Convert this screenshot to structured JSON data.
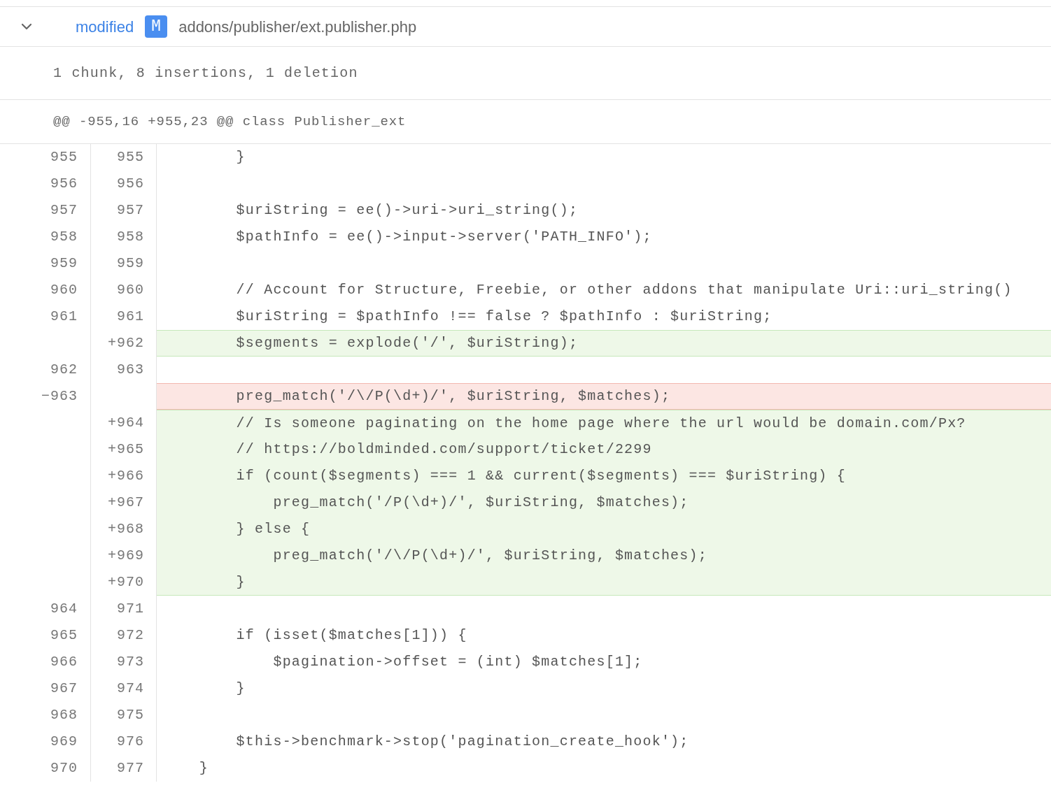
{
  "file": {
    "expanded": true,
    "status": "modified",
    "badge": "M",
    "path": "addons/publisher/ext.publisher.php"
  },
  "summary": "1 chunk, 8 insertions, 1 deletion",
  "hunk_header": "@@ -955,16 +955,23 @@ class Publisher_ext",
  "lines": [
    {
      "kind": "context",
      "old": "955",
      "new": "955",
      "code": "        }"
    },
    {
      "kind": "context",
      "old": "956",
      "new": "956"
    },
    {
      "kind": "context",
      "old": "957",
      "new": "957",
      "code": "        $uriString = ee()->uri->uri_string();"
    },
    {
      "kind": "context",
      "old": "958",
      "new": "958",
      "code": "        $pathInfo = ee()->input->server('PATH_INFO');"
    },
    {
      "kind": "context",
      "old": "959",
      "new": "959"
    },
    {
      "kind": "context",
      "old": "960",
      "new": "960",
      "code": "        // Account for Structure, Freebie, or other addons that manipulate Uri::uri_string()"
    },
    {
      "kind": "context",
      "old": "961",
      "new": "961",
      "code": "        $uriString = $pathInfo !== false ? $pathInfo : $uriString;"
    },
    {
      "kind": "add",
      "new": "+962",
      "code": "        $segments = explode('/', $uriString);"
    },
    {
      "kind": "context",
      "old": "962",
      "new": "963"
    },
    {
      "kind": "del",
      "old": "−963",
      "code": "        preg_match('/\\/P(\\d+)/', $uriString, $matches);"
    },
    {
      "kind": "add",
      "new": "+964",
      "code": "        // Is someone paginating on the home page where the url would be domain.com/Px?"
    },
    {
      "kind": "add",
      "new": "+965",
      "code": "        // https://boldminded.com/support/ticket/2299"
    },
    {
      "kind": "add",
      "new": "+966",
      "code": "        if (count($segments) === 1 && current($segments) === $uriString) {"
    },
    {
      "kind": "add",
      "new": "+967",
      "code": "            preg_match('/P(\\d+)/', $uriString, $matches);"
    },
    {
      "kind": "add",
      "new": "+968",
      "code": "        } else {"
    },
    {
      "kind": "add",
      "new": "+969",
      "code": "            preg_match('/\\/P(\\d+)/', $uriString, $matches);"
    },
    {
      "kind": "add",
      "new": "+970",
      "code": "        }"
    },
    {
      "kind": "context",
      "old": "964",
      "new": "971"
    },
    {
      "kind": "context",
      "old": "965",
      "new": "972",
      "code": "        if (isset($matches[1])) {"
    },
    {
      "kind": "context",
      "old": "966",
      "new": "973",
      "code": "            $pagination->offset = (int) $matches[1];"
    },
    {
      "kind": "context",
      "old": "967",
      "new": "974",
      "code": "        }"
    },
    {
      "kind": "context",
      "old": "968",
      "new": "975"
    },
    {
      "kind": "context",
      "old": "969",
      "new": "976",
      "code": "        $this->benchmark->stop('pagination_create_hook');"
    },
    {
      "kind": "context",
      "old": "970",
      "new": "977",
      "code": "    }"
    }
  ]
}
